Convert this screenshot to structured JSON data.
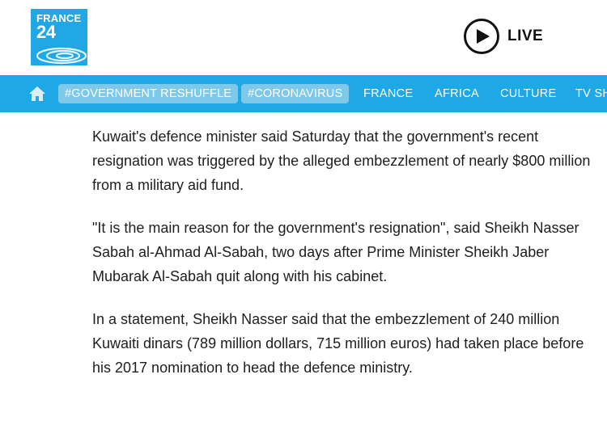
{
  "header": {
    "logo": {
      "line1": "FRANCE",
      "line2": "24",
      "bg_color": "#20a8e6"
    },
    "live": {
      "label": "LIVE",
      "icon": "play-circle-icon"
    }
  },
  "nav": {
    "bg_color": "#1ea8e6",
    "home_icon": "home-icon",
    "tags": [
      {
        "label": "#GOVERNMENT RESHUFFLE"
      },
      {
        "label": "#CORONAVIRUS"
      }
    ],
    "links": [
      {
        "label": "FRANCE"
      },
      {
        "label": "AFRICA"
      },
      {
        "label": "CULTURE"
      },
      {
        "label": "TV SH"
      }
    ]
  },
  "article": {
    "paragraphs": [
      "Kuwait's defence minister said Saturday that the government's recent resignation was triggered by the alleged embezzlement of nearly $800 million from a military aid fund.",
      "\"It is the main reason for the government's resignation\", said Sheikh Nasser Sabah al-Ahmad Al-Sabah, two days after Prime Minister Sheikh Jaber Mubarak Al-Sabah quit along with his cabinet.",
      "In a statement, Sheikh Nasser said that the embezzlement of 240 million Kuwaiti dinars (789 million dollars, 715 million euros) had taken place before his 2017 nomination to head the defence ministry."
    ]
  }
}
